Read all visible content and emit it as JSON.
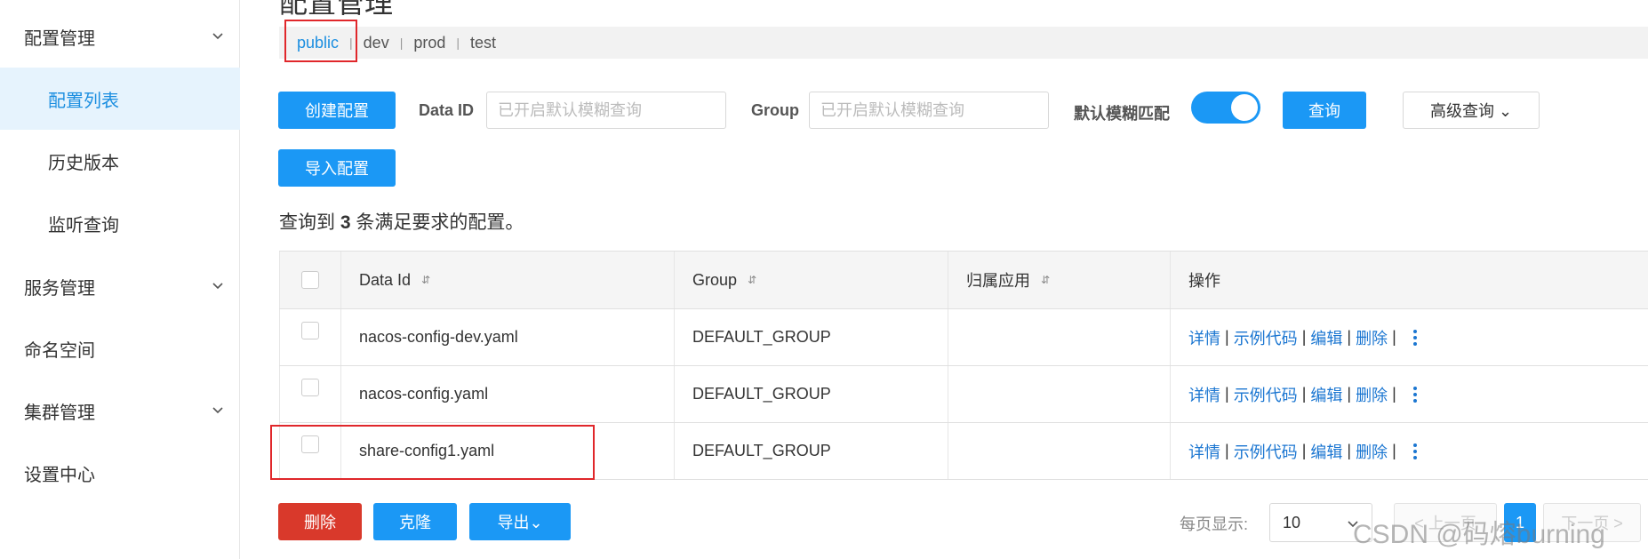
{
  "sidebar": {
    "items": [
      {
        "label": "配置管理",
        "expandable": true
      },
      {
        "label": "配置列表",
        "active": true
      },
      {
        "label": "历史版本"
      },
      {
        "label": "监听查询"
      },
      {
        "label": "服务管理",
        "expandable": true
      },
      {
        "label": "命名空间"
      },
      {
        "label": "集群管理",
        "expandable": true
      },
      {
        "label": "设置中心"
      }
    ]
  },
  "page": {
    "title": "配置管理"
  },
  "namespaces": [
    "public",
    "dev",
    "prod",
    "test"
  ],
  "toolbar": {
    "create_label": "创建配置",
    "import_label": "导入配置",
    "dataid_label": "Data ID",
    "dataid_placeholder": "已开启默认模糊查询",
    "group_label": "Group",
    "group_placeholder": "已开启默认模糊查询",
    "fuzzy_label": "默认模糊匹配",
    "fuzzy_enabled": true,
    "query_label": "查询",
    "advanced_label": "高级查询 ⌄"
  },
  "result": {
    "prefix": "查询到 ",
    "count": "3",
    "suffix": " 条满足要求的配置。"
  },
  "table": {
    "columns": [
      "Data Id",
      "Group",
      "归属应用",
      "操作"
    ],
    "rows": [
      {
        "data_id": "nacos-config-dev.yaml",
        "group": "DEFAULT_GROUP",
        "app": ""
      },
      {
        "data_id": "nacos-config.yaml",
        "group": "DEFAULT_GROUP",
        "app": ""
      },
      {
        "data_id": "share-config1.yaml",
        "group": "DEFAULT_GROUP",
        "app": ""
      }
    ],
    "actions": {
      "detail": "详情",
      "sample": "示例代码",
      "edit": "编辑",
      "delete": "删除",
      "sep": "|"
    }
  },
  "footer": {
    "delete_label": "删除",
    "clone_label": "克隆",
    "export_label": "导出⌄",
    "page_size_label": "每页显示:",
    "page_size": "10",
    "prev_label": "< 上一页",
    "current_page": "1",
    "next_label": "下一页 >"
  },
  "watermark": "CSDN @码熔burning",
  "colors": {
    "primary": "#1b98f5",
    "danger": "#d9392b",
    "link": "#1b76d1",
    "highlight": "#e0272b"
  }
}
